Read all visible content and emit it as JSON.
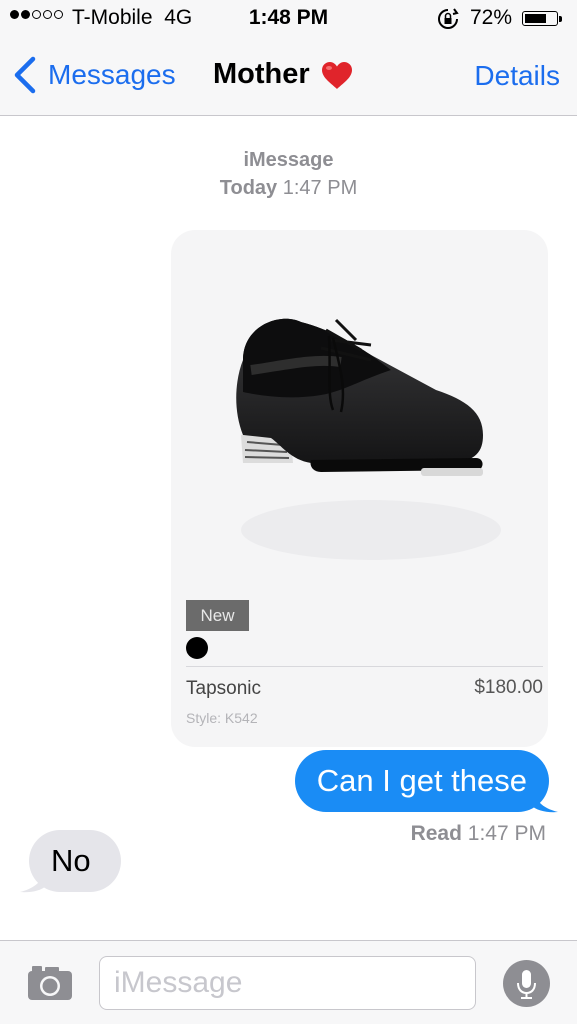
{
  "status_bar": {
    "signal_dots": [
      true,
      true,
      false,
      false,
      false
    ],
    "carrier": "T-Mobile",
    "network": "4G",
    "time": "1:48 PM",
    "battery_percent": "72%",
    "battery_level": 0.72
  },
  "nav": {
    "back_label": "Messages",
    "contact_name": "Mother",
    "contact_emoji": "heart-emoji",
    "details_label": "Details"
  },
  "conversation": {
    "service_label": "iMessage",
    "date_label": "Today",
    "time_label": "1:47 PM"
  },
  "product_card": {
    "image": "black-tap-shoe",
    "badge": "New",
    "color_swatch": "#000000",
    "name": "Tapsonic",
    "price": "$180.00",
    "style": "Style: K542"
  },
  "messages": [
    {
      "direction": "outgoing",
      "text": "Can I get these"
    },
    {
      "direction": "incoming",
      "text": "No"
    }
  ],
  "receipt": {
    "status": "Read",
    "time": "1:47 PM"
  },
  "input": {
    "placeholder": "iMessage",
    "value": ""
  },
  "icons": {
    "back": "chevron-left-icon",
    "camera": "camera-icon",
    "mic": "microphone-icon",
    "lock": "rotation-lock-icon"
  },
  "colors": {
    "accent": "#1b6dee",
    "outgoing_bubble": "#1a8cf5",
    "incoming_bubble": "#e5e5ea",
    "muted_text": "#8e8e93"
  }
}
